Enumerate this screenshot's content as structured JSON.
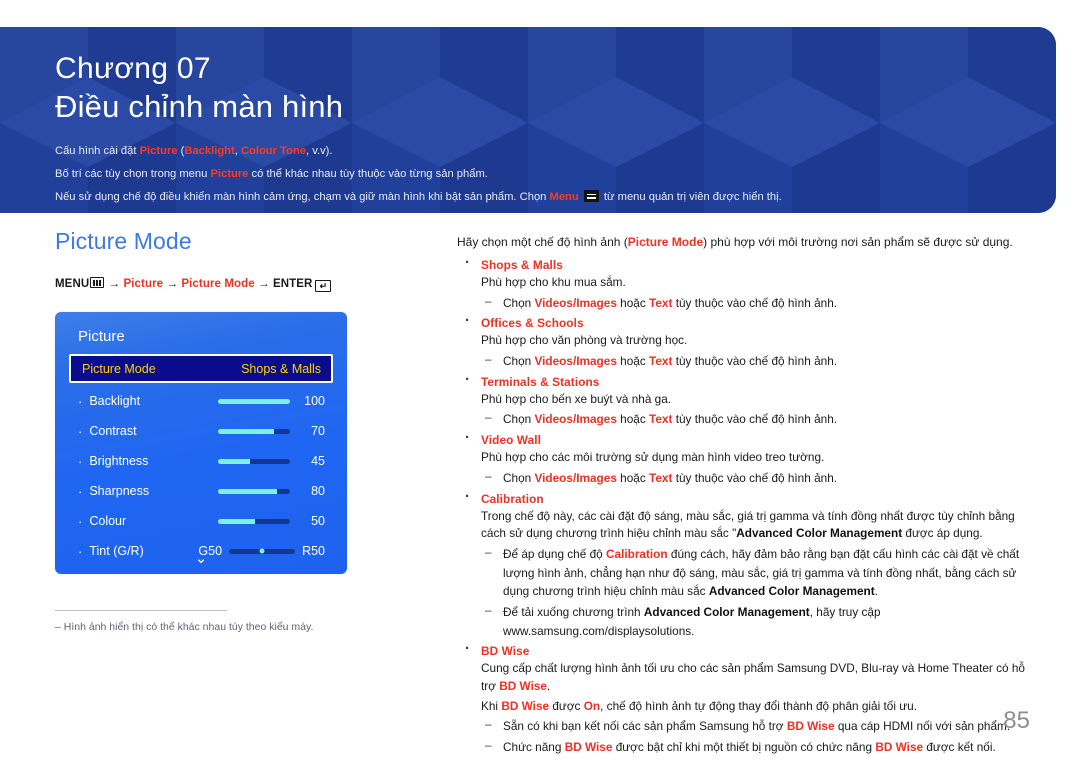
{
  "banner": {
    "chapter_label": "Chương 07",
    "chapter_title": "Điều chỉnh màn hình",
    "note1_a": "Cấu hình cài đặt ",
    "note1_picture": "Picture",
    "note1_b": " (",
    "note1_backlight": "Backlight",
    "note1_c": ", ",
    "note1_colour_tone": "Colour Tone",
    "note1_d": ", v.v).",
    "note2_a": "Bố trí các tùy chọn trong menu ",
    "note2_picture": "Picture",
    "note2_b": " có thể khác nhau tùy thuộc vào từng sản phẩm.",
    "note3_a": "Nếu sử dụng chế độ điều khiển màn hình cảm ứng, chạm và giữ màn hình khi bật sản phẩm. Chọn ",
    "note3_menu": "Menu",
    "note3_b": " từ menu quản trị viên được hiển thị."
  },
  "left": {
    "section_title": "Picture Mode",
    "menu_path": {
      "menu": "MENU",
      "arrow1": "→",
      "picture": "Picture",
      "arrow2": "→",
      "picture_mode": "Picture Mode",
      "arrow3": "→",
      "enter": "ENTER",
      "enter_glyph": "↵"
    },
    "osd": {
      "title": "Picture",
      "selected_row": {
        "label": "Picture Mode",
        "value": "Shops & Malls"
      },
      "rows": [
        {
          "label": "Backlight",
          "value": "100",
          "fill": 100
        },
        {
          "label": "Contrast",
          "value": "70",
          "fill": 70
        },
        {
          "label": "Brightness",
          "value": "45",
          "fill": 45
        },
        {
          "label": "Sharpness",
          "value": "80",
          "fill": 80
        },
        {
          "label": "Colour",
          "value": "50",
          "fill": 50
        }
      ],
      "tint": {
        "label": "Tint (G/R)",
        "left_value": "G50",
        "right_value": "R50"
      },
      "chevron": "⌄"
    },
    "footnote": "‒  Hình ảnh hiển thị có thể khác nhau tùy theo kiểu máy."
  },
  "right": {
    "intro_a": "Hãy chọn một chế độ hình ảnh (",
    "intro_picture_mode": "Picture Mode",
    "intro_b": ") phù hợp với môi trường nơi sản phẩm sẽ được sử dụng.",
    "sub_choose_a": "Chọn ",
    "sub_videos_images": "Videos/Images",
    "sub_choose_b": " hoặc ",
    "sub_text": "Text",
    "sub_choose_c": " tùy thuộc vào chế độ hình ảnh.",
    "items": [
      {
        "head": "Shops & Malls",
        "desc": "Phù hợp cho khu mua sắm."
      },
      {
        "head": "Offices & Schools",
        "desc": "Phù hợp cho văn phòng và trường học."
      },
      {
        "head": "Terminals & Stations",
        "desc": "Phù hợp cho bến xe buýt và nhà ga."
      },
      {
        "head": "Video Wall",
        "desc": "Phù hợp cho các môi trường sử dụng màn hình video treo tường."
      }
    ],
    "calibration": {
      "head": "Calibration",
      "desc_a": "Trong chế độ này, các cài đặt độ sáng, màu sắc, giá trị gamma và tính đồng nhất được tùy chỉnh bằng cách sử dụng chương trình hiệu chỉnh màu sắc \"",
      "desc_acm": "Advanced Color Management",
      "desc_b": " được áp dụng.",
      "sub1_a": "Để áp dụng chế độ ",
      "sub1_calibration": "Calibration",
      "sub1_b": " đúng cách, hãy đảm bảo rằng bạn đặt cấu hình các cài đặt về chất lượng hình ảnh, chẳng hạn như độ sáng, màu sắc, giá trị gamma và tính đồng nhất, bằng cách sử dụng chương trình hiệu chỉnh màu sắc ",
      "sub1_acm": "Advanced Color Management",
      "sub1_c": ".",
      "sub2_a": "Để tải xuống chương trình ",
      "sub2_acm": "Advanced Color Management",
      "sub2_b": ", hãy truy cập",
      "sub2_url": "www.samsung.com/displaysolutions."
    },
    "bdwise": {
      "head": "BD Wise",
      "desc_a": "Cung cấp chất lượng hình ảnh tối ưu cho các sản phẩm Samsung DVD, Blu-ray và Home Theater có hỗ trợ ",
      "desc_bd": "BD Wise",
      "desc_b": ".",
      "line2_a": "Khi ",
      "line2_bd": "BD Wise",
      "line2_b": " được ",
      "line2_on": "On",
      "line2_c": ", chế độ hình ảnh tự động thay đổi thành độ phân giải tối ưu.",
      "sub1_a": "Sẵn có khi bạn kết nối các sản phẩm Samsung hỗ trợ ",
      "sub1_bd": "BD Wise",
      "sub1_b": " qua cáp HDMI nối với sản phẩm.",
      "sub2_a": "Chức năng ",
      "sub2_bd": "BD Wise",
      "sub2_b": " được bật chỉ khi một thiết bị nguồn có chức năng ",
      "sub2_bd2": "BD Wise",
      "sub2_c": " được kết nối."
    }
  },
  "page_number": "85",
  "colors": {
    "banner_blue": "#22409a",
    "accent_red": "#ee3124",
    "heading_blue": "#3b7ae4",
    "osd_blue": "#1f66f2",
    "osd_selected": "#0b0b8e",
    "osd_yellow": "#ffd400",
    "slider_fill": "#7ff0e0",
    "slider_track": "#123a8c"
  }
}
